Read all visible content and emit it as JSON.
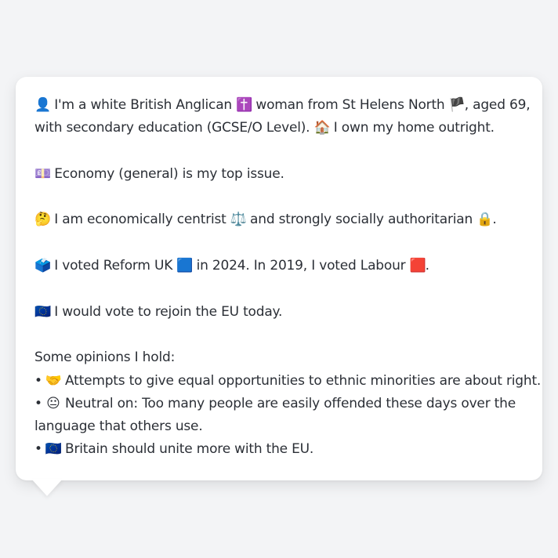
{
  "profile": {
    "line1": {
      "icon_person": "👤",
      "t1": " I'm a white British Anglican ",
      "icon_cross": "✝️",
      "t2": " woman from St Helens North ",
      "icon_flag": "🏴",
      "t3": ", aged 69,"
    },
    "line2": {
      "t1": "with secondary education (GCSE/O Level). ",
      "icon_house": "🏠",
      "t2": " I own my home outright."
    },
    "issue": {
      "icon": "💷",
      "text": " Economy (general) is my top issue."
    },
    "ideology": {
      "icon_think": "🤔",
      "t1": " I am economically centrist ",
      "icon_scale": "⚖️",
      "t2": " and strongly socially authoritarian ",
      "icon_lock": "🔒",
      "t3": "."
    },
    "vote": {
      "icon_ballot": "🗳️",
      "t1": " I voted Reform UK ",
      "icon_blue": "🟦",
      "t2": " in 2024. In 2019, I voted Labour ",
      "icon_red": "🟥",
      "t3": "."
    },
    "eu": {
      "icon": "🇪🇺",
      "text": " I would vote to rejoin the EU today."
    }
  },
  "opinions": {
    "heading": "Some opinions I hold:",
    "bullet": "•",
    "items": [
      {
        "icon": "🤝",
        "text": " Attempts to give equal opportunities to ethnic minorities are about right."
      },
      {
        "icon": "😐",
        "text": " Neutral on: Too many people are easily offended these days over the",
        "continuation": "language that others use."
      },
      {
        "icon": "🇪🇺",
        "text": " Britain should unite more with the EU."
      }
    ]
  }
}
